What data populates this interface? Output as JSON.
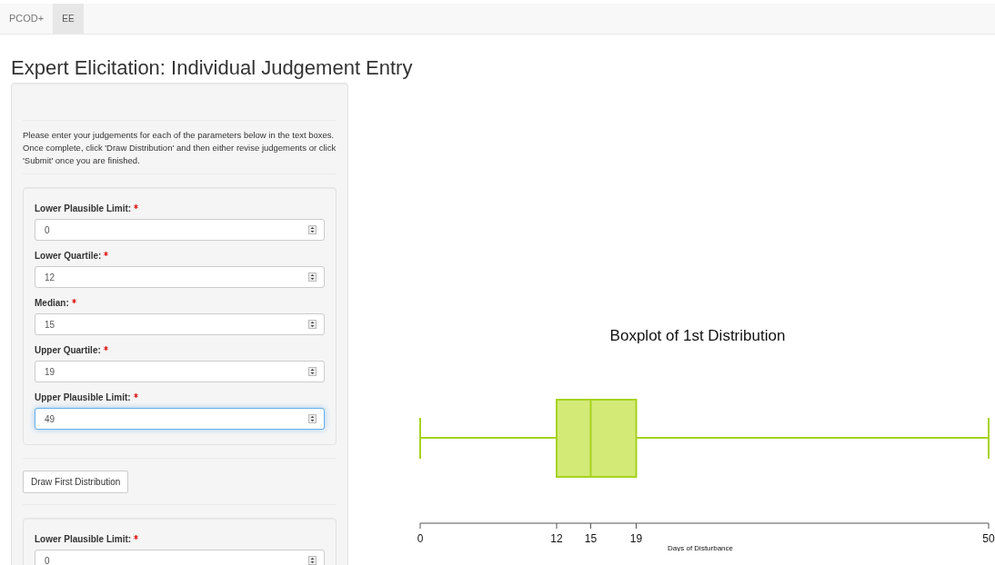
{
  "navbar": {
    "tabs": [
      {
        "label": "PCOD+",
        "selected": false
      },
      {
        "label": "EE",
        "selected": true
      }
    ]
  },
  "title": "Expert Elicitation: Individual Judgement Entry",
  "instructions": "Please enter your judgements for each of the parameters below in the text boxes. Once complete, click 'Draw Distribution' and then either revise judgements or click 'Submit' once you are finished.",
  "sections": [
    {
      "fields": [
        {
          "label": "Lower Plausible Limit:",
          "required": true,
          "value": "0",
          "focused": false
        },
        {
          "label": "Lower Quartile:",
          "required": true,
          "value": "12",
          "focused": false
        },
        {
          "label": "Median:",
          "required": true,
          "value": "15",
          "focused": false
        },
        {
          "label": "Upper Quartile:",
          "required": true,
          "value": "19",
          "focused": false
        },
        {
          "label": "Upper Plausible Limit:",
          "required": true,
          "value": "49",
          "focused": true
        }
      ],
      "button": "Draw First Distribution"
    },
    {
      "fields": [
        {
          "label": "Lower Plausible Limit:",
          "required": true,
          "value": "0",
          "focused": false
        }
      ]
    }
  ],
  "plot": {
    "title": "Boxplot of 1st Distribution",
    "ticks": [
      "0",
      "12",
      "15",
      "19",
      "50"
    ],
    "xlabel": "Days of Disturbance"
  }
}
